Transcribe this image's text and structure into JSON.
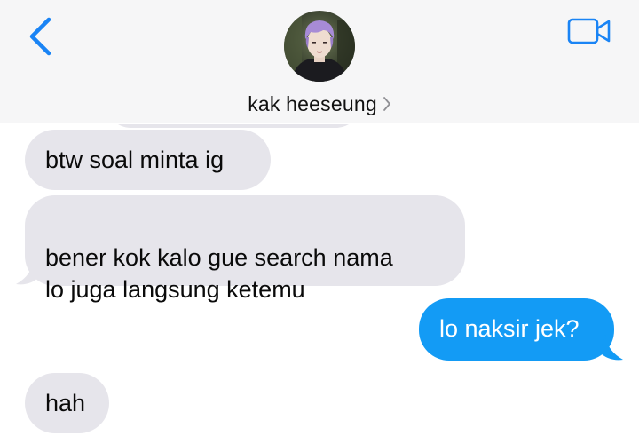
{
  "header": {
    "contact_name": "kak heeseung"
  },
  "messages": [
    {
      "direction": "in",
      "text": "btw soal minta ig"
    },
    {
      "direction": "in",
      "text": "bener kok kalo gue search nama\nlo juga langsung ketemu"
    },
    {
      "direction": "out",
      "text": "lo naksir jek?"
    },
    {
      "direction": "in",
      "text": "hah"
    }
  ],
  "colors": {
    "accent": "#1a84f5",
    "incoming_bubble": "#e6e5eb",
    "outgoing_bubble": "#139bf5",
    "header_bg": "#f6f6f7"
  },
  "icons": [
    "chevron-left-icon",
    "video-camera-icon",
    "chevron-right-icon"
  ]
}
